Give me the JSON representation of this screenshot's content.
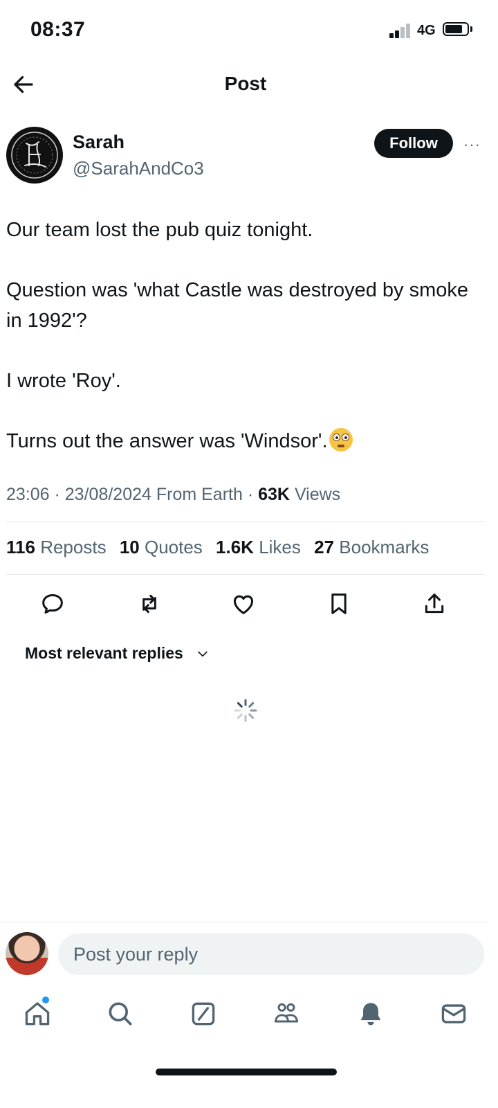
{
  "status_bar": {
    "time": "08:37",
    "network": "4G",
    "icons": [
      "signal-icon",
      "battery-icon"
    ]
  },
  "header": {
    "title": "Post",
    "back_icon": "arrow-left-icon"
  },
  "post": {
    "author": {
      "name": "Sarah",
      "handle": "@SarahAndCo3"
    },
    "follow_label": "Follow",
    "more_label": "···",
    "paragraphs": [
      "Our team lost the pub quiz tonight.",
      "Question was 'what Castle was destroyed by smoke in 1992'?",
      "I wrote 'Roy'.",
      "Turns out the answer was 'Windsor'."
    ],
    "emoji": "flushed-face-emoji",
    "meta": {
      "time": "23:06",
      "date": "23/08/2024",
      "source": "From Earth",
      "views_count": "63K",
      "views_label": "Views"
    },
    "stats": {
      "reposts_count": "116",
      "reposts_label": "Reposts",
      "quotes_count": "10",
      "quotes_label": "Quotes",
      "likes_count": "1.6K",
      "likes_label": "Likes",
      "bookmarks_count": "27",
      "bookmarks_label": "Bookmarks"
    },
    "actions": [
      "reply-icon",
      "repost-icon",
      "like-icon",
      "bookmark-icon",
      "share-icon"
    ]
  },
  "replies": {
    "sort_label": "Most relevant replies",
    "loading": true
  },
  "composer": {
    "placeholder": "Post your reply"
  },
  "bottom_nav": {
    "items": [
      "home-icon",
      "search-icon",
      "grok-icon",
      "communities-icon",
      "notifications-icon",
      "messages-icon"
    ],
    "home_has_badge": true
  },
  "colors": {
    "text": "#0f1419",
    "secondary": "#536471",
    "divider": "#e5e8eb",
    "accent": "#1d9bf0",
    "input_bg": "#eff3f4"
  }
}
